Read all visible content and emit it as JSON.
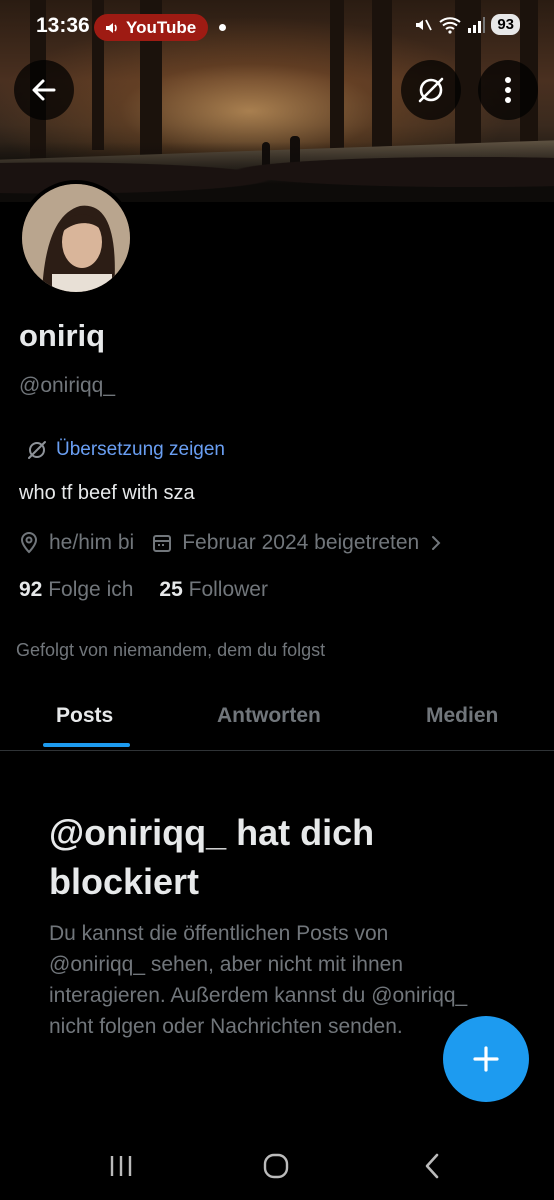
{
  "status_bar": {
    "time": "13:36",
    "app_chip": "YouTube",
    "battery": "93"
  },
  "header": {
    "back_icon": "arrow-left-icon",
    "translate_icon": "translate-icon",
    "more_icon": "more-vertical-icon"
  },
  "profile": {
    "name": "oniriq",
    "handle": "@oniriqq_",
    "translate_label": "Übersetzung zeigen",
    "bio": "who tf beef with sza",
    "location": "he/him bi",
    "joined": "Februar 2024 beigetreten",
    "following_count": "92",
    "following_label": "Folge ich",
    "followers_count": "25",
    "followers_label": "Follower",
    "followed_by": "Gefolgt von niemandem, dem du folgst"
  },
  "tabs": [
    {
      "label": "Posts",
      "active": true
    },
    {
      "label": "Antworten",
      "active": false
    },
    {
      "label": "Medien",
      "active": false
    }
  ],
  "blocked": {
    "title": "@oniriqq_ hat dich blockiert",
    "text": "Du kannst die öffentlichen Posts von @oniriqq_ sehen, aber nicht mit ihnen interagieren. Außerdem kannst du @oniriqq_ nicht folgen oder Nachrichten senden."
  },
  "fab_icon": "plus-icon",
  "colors": {
    "accent": "#1d9bf0",
    "link": "#6a9ff3",
    "muted": "#71767b",
    "youtube_chip": "#9e1b13"
  }
}
